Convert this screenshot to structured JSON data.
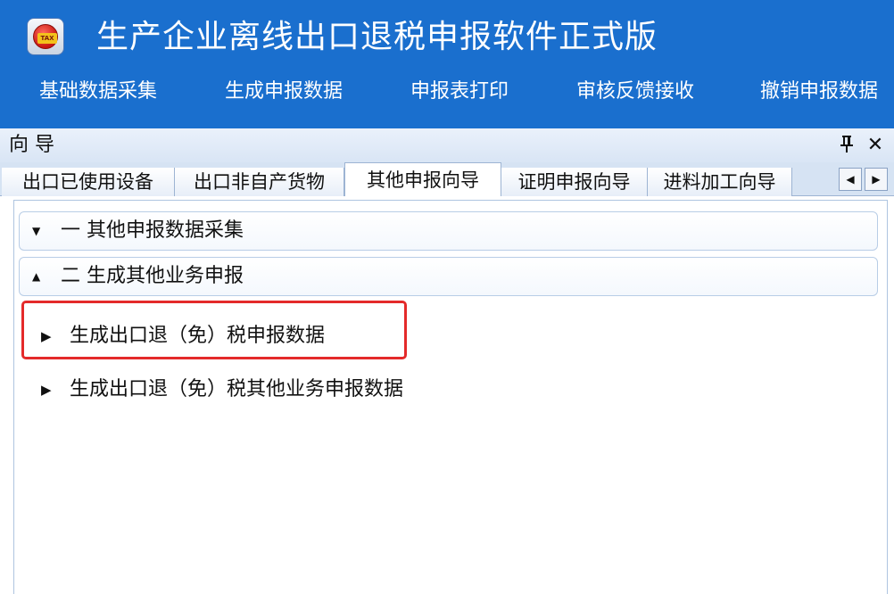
{
  "app": {
    "title": "生产企业离线出口退税申报软件正式版",
    "logo_text": "TAX",
    "header_color": "#1a6fce"
  },
  "menu": [
    {
      "label": "基础数据采集"
    },
    {
      "label": "生成申报数据"
    },
    {
      "label": "申报表打印"
    },
    {
      "label": "审核反馈接收"
    },
    {
      "label": "撤销申报数据"
    }
  ],
  "pane": {
    "title": "向 导",
    "pin_glyph": "ᴘ",
    "close_glyph": "✕"
  },
  "tabs": [
    {
      "label": "出口已使用设备"
    },
    {
      "label": "出口非自产货物"
    },
    {
      "label": "其他申报向导",
      "active": true
    },
    {
      "label": "证明申报向导"
    },
    {
      "label": "进料加工向导"
    }
  ],
  "tab_scroll": {
    "left": "◀",
    "right": "▶"
  },
  "sections": [
    {
      "chevron": "▼",
      "label": "一  其他申报数据采集",
      "expanded": false
    },
    {
      "chevron": "▲",
      "label": "二  生成其他业务申报",
      "expanded": true
    }
  ],
  "items": [
    {
      "arrow": "▶",
      "label": "生成出口退（免）税申报数据",
      "highlighted": true
    },
    {
      "arrow": "▶",
      "label": "生成出口退（免）税其他业务申报数据",
      "highlighted": false
    }
  ],
  "colors": {
    "highlight": "#e42a2a",
    "pane_border": "#aec4e0"
  }
}
